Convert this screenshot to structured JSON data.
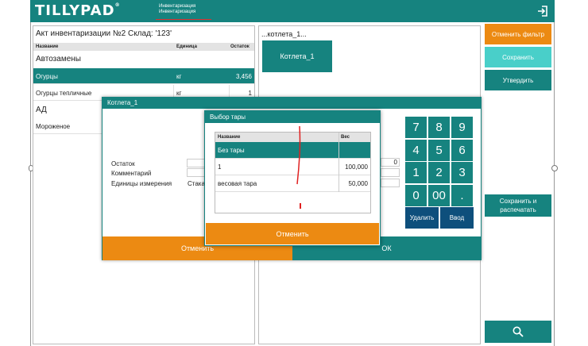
{
  "header": {
    "logo": "TILLYPAD",
    "logo_mark": "®",
    "crumb_line1": "Инвентаризация",
    "crumb_line2": "Инвентаризация"
  },
  "document": {
    "title": "Акт инвентаризации №2 Склад: '123'",
    "columns": [
      "Название",
      "Единица",
      "Остаток"
    ],
    "groups": [
      "Автозамены",
      "АД"
    ],
    "rows": [
      {
        "name": "Огурцы",
        "unit": "кг",
        "qty": "3,456"
      },
      {
        "name": "Огурцы тепличные",
        "unit": "кг",
        "qty": "1"
      },
      {
        "name": "Мороженое",
        "unit": "",
        "qty": ""
      }
    ]
  },
  "middle": {
    "title": "...котлета_1...",
    "tile": "Котлета_1"
  },
  "sidebar": {
    "reset_filter": "Отменить фильтр",
    "save": "Сохранить",
    "approve": "Утвердить",
    "save_print": "Сохранить и распечатать"
  },
  "item_dialog": {
    "title": "Котлета_1",
    "remain_label": "Остаток",
    "comment_label": "Комментарий",
    "unit_label": "Единицы измерения",
    "unit_value": "Стака",
    "remain_value": "0",
    "cancel": "Отменить",
    "ok": "ОК"
  },
  "numpad": {
    "keys": [
      "7",
      "8",
      "9",
      "4",
      "5",
      "6",
      "1",
      "2",
      "3",
      "0",
      "00",
      "."
    ],
    "delete": "Удалить",
    "enter": "Ввод"
  },
  "tare_dialog": {
    "title": "Выбор тары",
    "columns": [
      "Название",
      "Вес"
    ],
    "rows": [
      {
        "name": "Без тары",
        "weight": ""
      },
      {
        "name": "1",
        "weight": "100,000"
      },
      {
        "name": "весовая тара",
        "weight": "50,000"
      }
    ],
    "cancel": "Отменить"
  },
  "colors": {
    "teal": "#16837f",
    "orange": "#ec8a12",
    "light_teal": "#49cfc9",
    "navy": "#0e4f7c"
  }
}
